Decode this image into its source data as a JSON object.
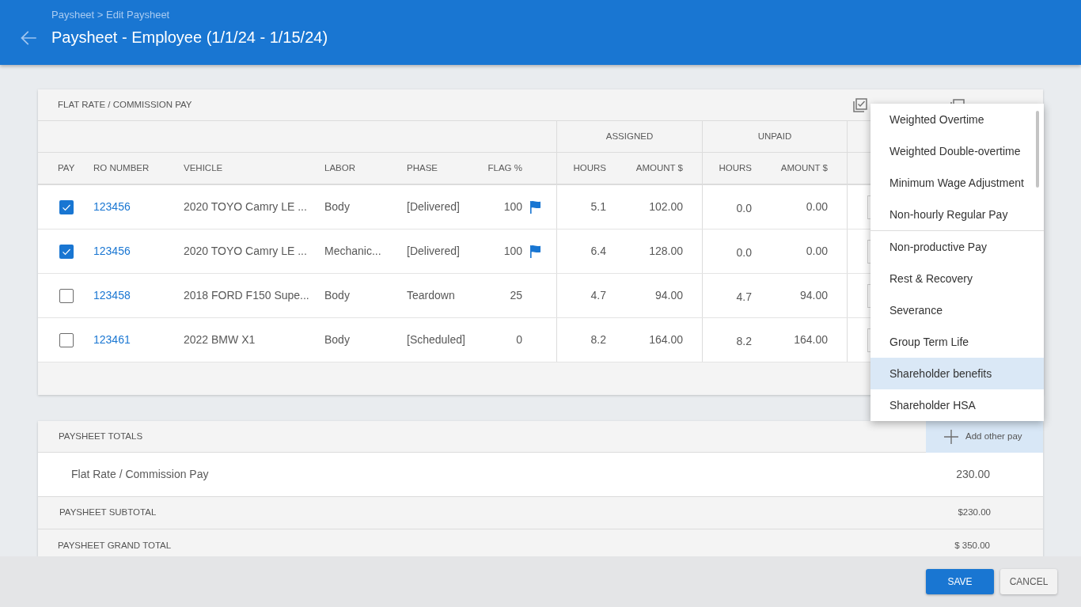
{
  "header": {
    "breadcrumb": "Paysheet > Edit Paysheet",
    "title": "Paysheet - Employee (1/1/24 - 1/15/24)"
  },
  "flat_rate_card": {
    "title": "FLAT RATE / COMMISSION PAY",
    "actions": [
      {
        "kind": "select"
      },
      {
        "kind": "deselect"
      }
    ],
    "column_groups": [
      "ASSIGNED",
      "UNPAID"
    ],
    "columns": [
      "PAY",
      "RO NUMBER",
      "VEHICLE",
      "LABOR",
      "PHASE",
      "FLAG %",
      "HOURS",
      "AMOUNT $",
      "HOURS",
      "AMOUNT $"
    ],
    "rows": [
      {
        "checked": true,
        "ro_number": "123456",
        "vehicle": "2020 TOYO Camry LE ...",
        "labor": "Body",
        "phase": "[Delivered]",
        "flag_pct": "100",
        "flagged": true,
        "assigned_hours": "5.1",
        "assigned_amount": "102.00",
        "unpaid_hours": "0.0",
        "unpaid_amount": "0.00"
      },
      {
        "checked": true,
        "ro_number": "123456",
        "vehicle": "2020 TOYO Camry LE ...",
        "labor": "Mechanic...",
        "phase": "[Delivered]",
        "flag_pct": "100",
        "flagged": true,
        "assigned_hours": "6.4",
        "assigned_amount": "128.00",
        "unpaid_hours": "0.0",
        "unpaid_amount": "0.00"
      },
      {
        "checked": false,
        "ro_number": "123458",
        "vehicle": "2018 FORD F150 Supe...",
        "labor": "Body",
        "phase": "Teardown",
        "flag_pct": "25",
        "flagged": false,
        "assigned_hours": "4.7",
        "assigned_amount": "94.00",
        "unpaid_hours": "4.7",
        "unpaid_amount": "94.00"
      },
      {
        "checked": false,
        "ro_number": "123461",
        "vehicle": "2022 BMW X1",
        "labor": "Body",
        "phase": "[Scheduled]",
        "flag_pct": "0",
        "flagged": false,
        "assigned_hours": "8.2",
        "assigned_amount": "164.00",
        "unpaid_hours": "8.2",
        "unpaid_amount": "164.00"
      }
    ]
  },
  "totals_card": {
    "title": "PAYSHEET TOTALS",
    "add_button": "Add other pay",
    "lines": [
      {
        "label": "Flat Rate / Commission Pay",
        "amount": "230.00"
      }
    ],
    "subtotal": {
      "label": "PAYSHEET SUBTOTAL",
      "amount": "$230.00"
    },
    "grand_total": {
      "label": "PAYSHEET GRAND TOTAL",
      "amount": "$ 350.00"
    }
  },
  "pay_type_menu": {
    "groups": [
      {
        "items": [
          {
            "label": "Weighted Overtime",
            "selected": false
          },
          {
            "label": "Weighted Double-overtime",
            "selected": false
          },
          {
            "label": "Minimum Wage Adjustment",
            "selected": false
          },
          {
            "label": "Non-hourly Regular Pay",
            "selected": false
          }
        ]
      },
      {
        "items": [
          {
            "label": "Non-productive Pay",
            "selected": false
          },
          {
            "label": "Rest & Recovery",
            "selected": false
          },
          {
            "label": "Severance",
            "selected": false
          },
          {
            "label": "Group Term Life",
            "selected": false
          },
          {
            "label": "Shareholder benefits",
            "selected": true
          },
          {
            "label": "Shareholder HSA",
            "selected": false
          }
        ]
      }
    ]
  },
  "footer": {
    "buttons": [
      {
        "kind": "primary",
        "label": "SAVE"
      },
      {
        "kind": "secondary",
        "label": "CANCEL"
      }
    ]
  }
}
